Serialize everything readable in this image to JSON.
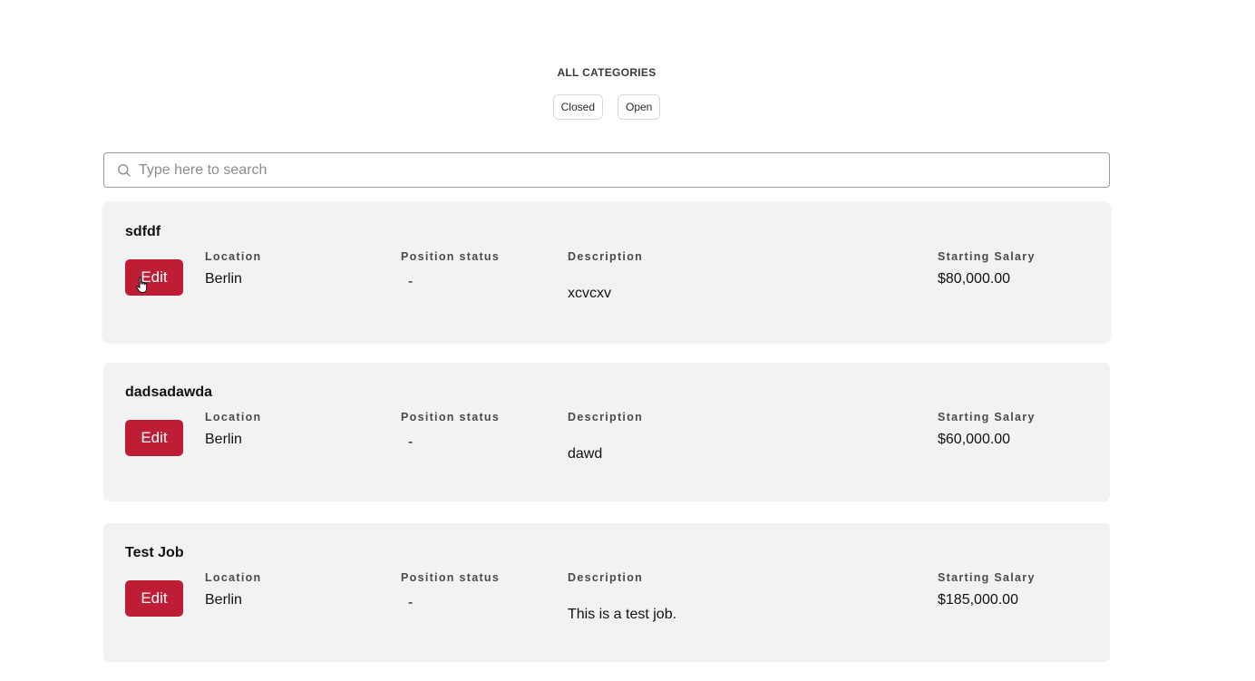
{
  "filters": {
    "heading": "ALL CATEGORIES",
    "options": [
      "Closed",
      "Open"
    ]
  },
  "search": {
    "placeholder": "Type here to search",
    "value": ""
  },
  "labels": {
    "location": "Location",
    "status": "Position status",
    "description": "Description",
    "salary": "Starting Salary",
    "edit": "Edit"
  },
  "jobs": [
    {
      "title": "sdfdf",
      "location": "Berlin",
      "status": "-",
      "description": "xcvcxv",
      "salary": "$80,000.00"
    },
    {
      "title": "dadsadawda",
      "location": "Berlin",
      "status": "-",
      "description": "dawd",
      "salary": "$60,000.00"
    },
    {
      "title": "Test Job",
      "location": "Berlin",
      "status": "-",
      "description": "This is a test job.",
      "salary": "$185,000.00"
    }
  ],
  "colors": {
    "accent": "#be1e35",
    "card_background": "#f2f2f2"
  }
}
